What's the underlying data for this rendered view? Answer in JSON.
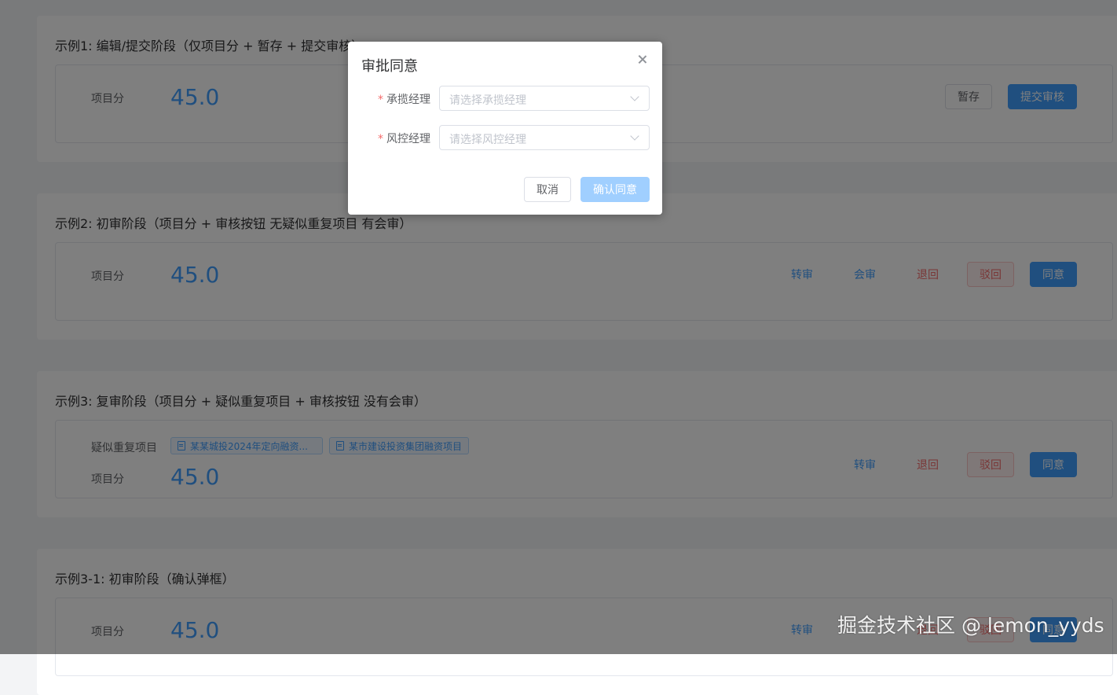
{
  "examples": [
    {
      "title": "示例1: 编辑/提交阶段（仅项目分 + 暂存 + 提交审核）",
      "score_label": "项目分",
      "score": "45.0",
      "actions": [
        "暂存",
        "提交审核"
      ]
    },
    {
      "title": "示例2: 初审阶段（项目分 + 审核按钮 无疑似重复项目 有会审）",
      "score_label": "项目分",
      "score": "45.0",
      "actions": [
        "转审",
        "会审",
        "退回",
        "驳回",
        "同意"
      ]
    },
    {
      "title": "示例3: 复审阶段（项目分 + 疑似重复项目 + 审核按钮 没有会审）",
      "dup_label": "疑似重复项目",
      "dup_items": [
        "某某城投2024年定向融资...",
        "某市建设投资集团融资项目"
      ],
      "score_label": "项目分",
      "score": "45.0",
      "actions": [
        "转审",
        "退回",
        "驳回",
        "同意"
      ]
    },
    {
      "title": "示例3-1: 初审阶段（确认弹框）",
      "score_label": "项目分",
      "score": "45.0",
      "actions": [
        "转审",
        "退回",
        "驳回",
        "同意"
      ]
    }
  ],
  "dialog": {
    "title": "审批同意",
    "fields": [
      {
        "label": "承揽经理",
        "placeholder": "请选择承揽经理",
        "required": true
      },
      {
        "label": "风控经理",
        "placeholder": "请选择风控经理",
        "required": true
      }
    ],
    "cancel": "取消",
    "confirm": "确认同意"
  },
  "watermark": "掘金技术社区 @ lemon_yyds",
  "colors": {
    "primary": "#409eff",
    "danger": "#f56c6c",
    "overlay": "rgba(0,0,0,0.5)"
  }
}
